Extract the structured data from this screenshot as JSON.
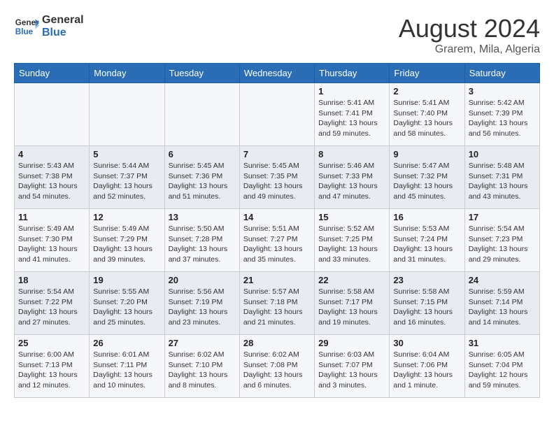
{
  "logo": {
    "line1": "General",
    "line2": "Blue"
  },
  "title": "August 2024",
  "location": "Grarem, Mila, Algeria",
  "weekdays": [
    "Sunday",
    "Monday",
    "Tuesday",
    "Wednesday",
    "Thursday",
    "Friday",
    "Saturday"
  ],
  "weeks": [
    [
      {
        "day": "",
        "info": ""
      },
      {
        "day": "",
        "info": ""
      },
      {
        "day": "",
        "info": ""
      },
      {
        "day": "",
        "info": ""
      },
      {
        "day": "1",
        "info": "Sunrise: 5:41 AM\nSunset: 7:41 PM\nDaylight: 13 hours\nand 59 minutes."
      },
      {
        "day": "2",
        "info": "Sunrise: 5:41 AM\nSunset: 7:40 PM\nDaylight: 13 hours\nand 58 minutes."
      },
      {
        "day": "3",
        "info": "Sunrise: 5:42 AM\nSunset: 7:39 PM\nDaylight: 13 hours\nand 56 minutes."
      }
    ],
    [
      {
        "day": "4",
        "info": "Sunrise: 5:43 AM\nSunset: 7:38 PM\nDaylight: 13 hours\nand 54 minutes."
      },
      {
        "day": "5",
        "info": "Sunrise: 5:44 AM\nSunset: 7:37 PM\nDaylight: 13 hours\nand 52 minutes."
      },
      {
        "day": "6",
        "info": "Sunrise: 5:45 AM\nSunset: 7:36 PM\nDaylight: 13 hours\nand 51 minutes."
      },
      {
        "day": "7",
        "info": "Sunrise: 5:45 AM\nSunset: 7:35 PM\nDaylight: 13 hours\nand 49 minutes."
      },
      {
        "day": "8",
        "info": "Sunrise: 5:46 AM\nSunset: 7:33 PM\nDaylight: 13 hours\nand 47 minutes."
      },
      {
        "day": "9",
        "info": "Sunrise: 5:47 AM\nSunset: 7:32 PM\nDaylight: 13 hours\nand 45 minutes."
      },
      {
        "day": "10",
        "info": "Sunrise: 5:48 AM\nSunset: 7:31 PM\nDaylight: 13 hours\nand 43 minutes."
      }
    ],
    [
      {
        "day": "11",
        "info": "Sunrise: 5:49 AM\nSunset: 7:30 PM\nDaylight: 13 hours\nand 41 minutes."
      },
      {
        "day": "12",
        "info": "Sunrise: 5:49 AM\nSunset: 7:29 PM\nDaylight: 13 hours\nand 39 minutes."
      },
      {
        "day": "13",
        "info": "Sunrise: 5:50 AM\nSunset: 7:28 PM\nDaylight: 13 hours\nand 37 minutes."
      },
      {
        "day": "14",
        "info": "Sunrise: 5:51 AM\nSunset: 7:27 PM\nDaylight: 13 hours\nand 35 minutes."
      },
      {
        "day": "15",
        "info": "Sunrise: 5:52 AM\nSunset: 7:25 PM\nDaylight: 13 hours\nand 33 minutes."
      },
      {
        "day": "16",
        "info": "Sunrise: 5:53 AM\nSunset: 7:24 PM\nDaylight: 13 hours\nand 31 minutes."
      },
      {
        "day": "17",
        "info": "Sunrise: 5:54 AM\nSunset: 7:23 PM\nDaylight: 13 hours\nand 29 minutes."
      }
    ],
    [
      {
        "day": "18",
        "info": "Sunrise: 5:54 AM\nSunset: 7:22 PM\nDaylight: 13 hours\nand 27 minutes."
      },
      {
        "day": "19",
        "info": "Sunrise: 5:55 AM\nSunset: 7:20 PM\nDaylight: 13 hours\nand 25 minutes."
      },
      {
        "day": "20",
        "info": "Sunrise: 5:56 AM\nSunset: 7:19 PM\nDaylight: 13 hours\nand 23 minutes."
      },
      {
        "day": "21",
        "info": "Sunrise: 5:57 AM\nSunset: 7:18 PM\nDaylight: 13 hours\nand 21 minutes."
      },
      {
        "day": "22",
        "info": "Sunrise: 5:58 AM\nSunset: 7:17 PM\nDaylight: 13 hours\nand 19 minutes."
      },
      {
        "day": "23",
        "info": "Sunrise: 5:58 AM\nSunset: 7:15 PM\nDaylight: 13 hours\nand 16 minutes."
      },
      {
        "day": "24",
        "info": "Sunrise: 5:59 AM\nSunset: 7:14 PM\nDaylight: 13 hours\nand 14 minutes."
      }
    ],
    [
      {
        "day": "25",
        "info": "Sunrise: 6:00 AM\nSunset: 7:13 PM\nDaylight: 13 hours\nand 12 minutes."
      },
      {
        "day": "26",
        "info": "Sunrise: 6:01 AM\nSunset: 7:11 PM\nDaylight: 13 hours\nand 10 minutes."
      },
      {
        "day": "27",
        "info": "Sunrise: 6:02 AM\nSunset: 7:10 PM\nDaylight: 13 hours\nand 8 minutes."
      },
      {
        "day": "28",
        "info": "Sunrise: 6:02 AM\nSunset: 7:08 PM\nDaylight: 13 hours\nand 6 minutes."
      },
      {
        "day": "29",
        "info": "Sunrise: 6:03 AM\nSunset: 7:07 PM\nDaylight: 13 hours\nand 3 minutes."
      },
      {
        "day": "30",
        "info": "Sunrise: 6:04 AM\nSunset: 7:06 PM\nDaylight: 13 hours\nand 1 minute."
      },
      {
        "day": "31",
        "info": "Sunrise: 6:05 AM\nSunset: 7:04 PM\nDaylight: 12 hours\nand 59 minutes."
      }
    ]
  ]
}
